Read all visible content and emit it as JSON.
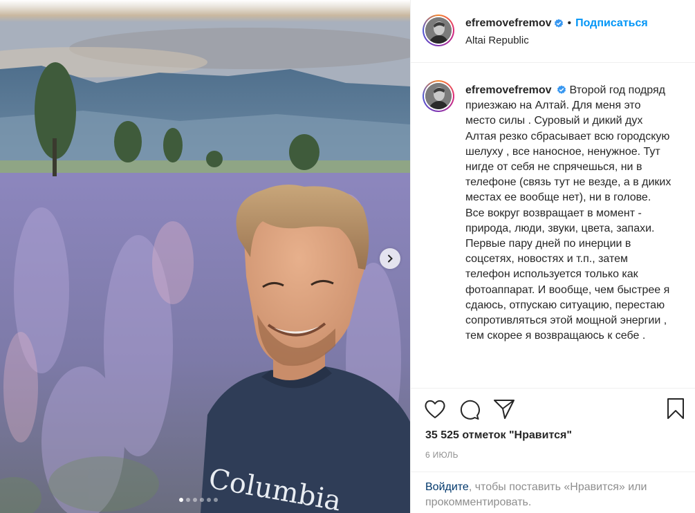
{
  "post": {
    "username": "efremovefremov",
    "dot": "•",
    "follow_label": "Подписаться",
    "location": "Altai Republic",
    "caption": "Второй год подряд приезжаю на Алтай. Для меня это место силы . Суровый и дикий дух Алтая резко сбрасывает всю городскую шелуху , все наносное, ненужное. Тут нигде от себя не спрячешься, ни в телефоне (связь тут не везде, а в диких местах ее вообще нет), ни в голове. Все вокруг возвращает в момент - природа, люди, звуки, цвета, запахи. Первые пару дней по инерции в соцсетях, новостях и т.п., затем телефон используется только как фотоаппарат. И вообще, чем быстрее я сдаюсь, отпускаю ситуацию, перестаю сопротивляться этой мощной энергии , тем скорее я возвращаюсь к себе .",
    "likes_text": "35 525 отметок \"Нравится\"",
    "date": "6 ИЮЛЬ",
    "login_link": "Войдите",
    "login_rest": ", чтобы поставить «Нравится» или прокомментировать.",
    "shirt_text": "Columbia"
  },
  "carousel": {
    "slide_count": 6,
    "active_index": 0
  },
  "colors": {
    "accent": "#0095f6",
    "verified": "#3897f0",
    "text": "#262626",
    "muted": "#8e8e8e",
    "link": "#00376b"
  },
  "icons": [
    "heart-icon",
    "comment-icon",
    "share-icon",
    "bookmark-icon",
    "chevron-right-icon",
    "verified-icon"
  ]
}
